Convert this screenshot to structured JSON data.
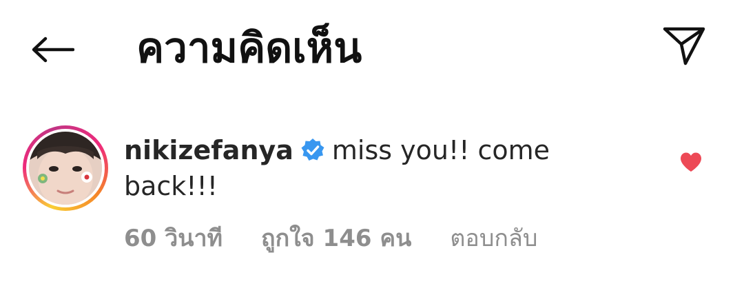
{
  "header": {
    "back_icon": "arrow-left-icon",
    "title": "ความคิดเห็น",
    "share_icon": "paper-plane-icon"
  },
  "comment": {
    "username": "nikizefanya",
    "verified_icon": "verified-badge-icon",
    "text": "miss you!! come back!!!",
    "time": "60 วินาที",
    "likes": "ถูกใจ 146 คน",
    "reply_label": "ตอบกลับ",
    "like_icon": "heart-filled-icon",
    "like_color": "#ed4956",
    "verified_color": "#3897f0"
  }
}
